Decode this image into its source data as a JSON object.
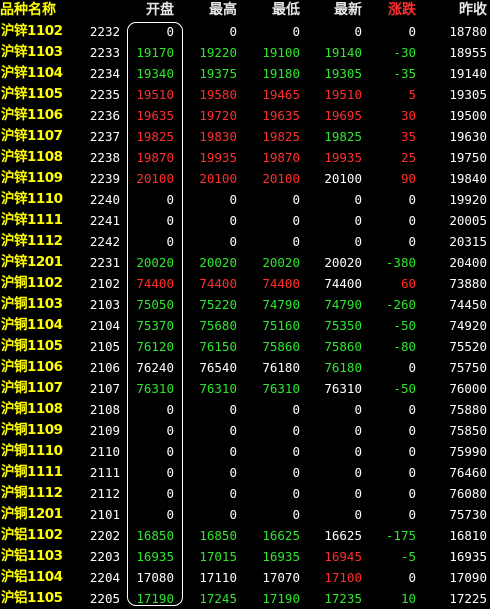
{
  "colors": {
    "up": "#ff2d2d",
    "down": "#2ee62e",
    "flat": "#ffffff",
    "name": "#ffff00",
    "header": "#e6e6e6",
    "code": "#ffffff",
    "prev_close": "#ffffff"
  },
  "header": {
    "name": "品种名称",
    "open": "开盘",
    "high": "最高",
    "low": "最低",
    "last": "最新",
    "change": "涨跌",
    "prev_close": "昨收"
  },
  "rows": [
    {
      "name": "沪锌1102",
      "code": "2232",
      "open": "0",
      "high": "0",
      "low": "0",
      "last": "0",
      "change": "0",
      "prev_close": "18780",
      "open_dir": "flat",
      "high_dir": "flat",
      "low_dir": "flat",
      "last_dir": "flat",
      "change_dir": "flat"
    },
    {
      "name": "沪锌1103",
      "code": "2233",
      "open": "19170",
      "high": "19220",
      "low": "19100",
      "last": "19140",
      "change": "-30",
      "prev_close": "18955",
      "open_dir": "down",
      "high_dir": "down",
      "low_dir": "down",
      "last_dir": "down",
      "change_dir": "down"
    },
    {
      "name": "沪锌1104",
      "code": "2234",
      "open": "19340",
      "high": "19375",
      "low": "19180",
      "last": "19305",
      "change": "-35",
      "prev_close": "19140",
      "open_dir": "down",
      "high_dir": "down",
      "low_dir": "down",
      "last_dir": "down",
      "change_dir": "down"
    },
    {
      "name": "沪锌1105",
      "code": "2235",
      "open": "19510",
      "high": "19580",
      "low": "19465",
      "last": "19510",
      "change": "5",
      "prev_close": "19305",
      "open_dir": "up",
      "high_dir": "up",
      "low_dir": "up",
      "last_dir": "up",
      "change_dir": "up"
    },
    {
      "name": "沪锌1106",
      "code": "2236",
      "open": "19635",
      "high": "19720",
      "low": "19635",
      "last": "19695",
      "change": "30",
      "prev_close": "19500",
      "open_dir": "up",
      "high_dir": "up",
      "low_dir": "up",
      "last_dir": "up",
      "change_dir": "up"
    },
    {
      "name": "沪锌1107",
      "code": "2237",
      "open": "19825",
      "high": "19830",
      "low": "19825",
      "last": "19825",
      "change": "35",
      "prev_close": "19630",
      "open_dir": "up",
      "high_dir": "up",
      "low_dir": "up",
      "last_dir": "down",
      "change_dir": "up"
    },
    {
      "name": "沪锌1108",
      "code": "2238",
      "open": "19870",
      "high": "19935",
      "low": "19870",
      "last": "19935",
      "change": "25",
      "prev_close": "19750",
      "open_dir": "up",
      "high_dir": "up",
      "low_dir": "up",
      "last_dir": "up",
      "change_dir": "up"
    },
    {
      "name": "沪锌1109",
      "code": "2239",
      "open": "20100",
      "high": "20100",
      "low": "20100",
      "last": "20100",
      "change": "90",
      "prev_close": "19840",
      "open_dir": "up",
      "high_dir": "up",
      "low_dir": "up",
      "last_dir": "flat",
      "change_dir": "up"
    },
    {
      "name": "沪锌1110",
      "code": "2240",
      "open": "0",
      "high": "0",
      "low": "0",
      "last": "0",
      "change": "0",
      "prev_close": "19920",
      "open_dir": "flat",
      "high_dir": "flat",
      "low_dir": "flat",
      "last_dir": "flat",
      "change_dir": "flat"
    },
    {
      "name": "沪锌1111",
      "code": "2241",
      "open": "0",
      "high": "0",
      "low": "0",
      "last": "0",
      "change": "0",
      "prev_close": "20005",
      "open_dir": "flat",
      "high_dir": "flat",
      "low_dir": "flat",
      "last_dir": "flat",
      "change_dir": "flat"
    },
    {
      "name": "沪锌1112",
      "code": "2242",
      "open": "0",
      "high": "0",
      "low": "0",
      "last": "0",
      "change": "0",
      "prev_close": "20315",
      "open_dir": "flat",
      "high_dir": "flat",
      "low_dir": "flat",
      "last_dir": "flat",
      "change_dir": "flat"
    },
    {
      "name": "沪锌1201",
      "code": "2231",
      "open": "20020",
      "high": "20020",
      "low": "20020",
      "last": "20020",
      "change": "-380",
      "prev_close": "20400",
      "open_dir": "down",
      "high_dir": "down",
      "low_dir": "down",
      "last_dir": "flat",
      "change_dir": "down"
    },
    {
      "name": "沪铜1102",
      "code": "2102",
      "open": "74400",
      "high": "74400",
      "low": "74400",
      "last": "74400",
      "change": "60",
      "prev_close": "73880",
      "open_dir": "up",
      "high_dir": "up",
      "low_dir": "up",
      "last_dir": "flat",
      "change_dir": "up"
    },
    {
      "name": "沪铜1103",
      "code": "2103",
      "open": "75050",
      "high": "75220",
      "low": "74790",
      "last": "74790",
      "change": "-260",
      "prev_close": "74450",
      "open_dir": "down",
      "high_dir": "down",
      "low_dir": "down",
      "last_dir": "down",
      "change_dir": "down"
    },
    {
      "name": "沪铜1104",
      "code": "2104",
      "open": "75370",
      "high": "75680",
      "low": "75160",
      "last": "75350",
      "change": "-50",
      "prev_close": "74920",
      "open_dir": "down",
      "high_dir": "down",
      "low_dir": "down",
      "last_dir": "down",
      "change_dir": "down"
    },
    {
      "name": "沪铜1105",
      "code": "2105",
      "open": "76120",
      "high": "76150",
      "low": "75860",
      "last": "75860",
      "change": "-80",
      "prev_close": "75520",
      "open_dir": "down",
      "high_dir": "down",
      "low_dir": "down",
      "last_dir": "down",
      "change_dir": "down"
    },
    {
      "name": "沪铜1106",
      "code": "2106",
      "open": "76240",
      "high": "76540",
      "low": "76180",
      "last": "76180",
      "change": "0",
      "prev_close": "75750",
      "open_dir": "flat",
      "high_dir": "flat",
      "low_dir": "flat",
      "last_dir": "down",
      "change_dir": "flat"
    },
    {
      "name": "沪铜1107",
      "code": "2107",
      "open": "76310",
      "high": "76310",
      "low": "76310",
      "last": "76310",
      "change": "-50",
      "prev_close": "76000",
      "open_dir": "down",
      "high_dir": "down",
      "low_dir": "down",
      "last_dir": "flat",
      "change_dir": "down"
    },
    {
      "name": "沪铜1108",
      "code": "2108",
      "open": "0",
      "high": "0",
      "low": "0",
      "last": "0",
      "change": "0",
      "prev_close": "75880",
      "open_dir": "flat",
      "high_dir": "flat",
      "low_dir": "flat",
      "last_dir": "flat",
      "change_dir": "flat"
    },
    {
      "name": "沪铜1109",
      "code": "2109",
      "open": "0",
      "high": "0",
      "low": "0",
      "last": "0",
      "change": "0",
      "prev_close": "75850",
      "open_dir": "flat",
      "high_dir": "flat",
      "low_dir": "flat",
      "last_dir": "flat",
      "change_dir": "flat"
    },
    {
      "name": "沪铜1110",
      "code": "2110",
      "open": "0",
      "high": "0",
      "low": "0",
      "last": "0",
      "change": "0",
      "prev_close": "75990",
      "open_dir": "flat",
      "high_dir": "flat",
      "low_dir": "flat",
      "last_dir": "flat",
      "change_dir": "flat"
    },
    {
      "name": "沪铜1111",
      "code": "2111",
      "open": "0",
      "high": "0",
      "low": "0",
      "last": "0",
      "change": "0",
      "prev_close": "76460",
      "open_dir": "flat",
      "high_dir": "flat",
      "low_dir": "flat",
      "last_dir": "flat",
      "change_dir": "flat"
    },
    {
      "name": "沪铜1112",
      "code": "2112",
      "open": "0",
      "high": "0",
      "low": "0",
      "last": "0",
      "change": "0",
      "prev_close": "76080",
      "open_dir": "flat",
      "high_dir": "flat",
      "low_dir": "flat",
      "last_dir": "flat",
      "change_dir": "flat"
    },
    {
      "name": "沪铜1201",
      "code": "2101",
      "open": "0",
      "high": "0",
      "low": "0",
      "last": "0",
      "change": "0",
      "prev_close": "75730",
      "open_dir": "flat",
      "high_dir": "flat",
      "low_dir": "flat",
      "last_dir": "flat",
      "change_dir": "flat"
    },
    {
      "name": "沪铝1102",
      "code": "2202",
      "open": "16850",
      "high": "16850",
      "low": "16625",
      "last": "16625",
      "change": "-175",
      "prev_close": "16810",
      "open_dir": "down",
      "high_dir": "down",
      "low_dir": "down",
      "last_dir": "flat",
      "change_dir": "down"
    },
    {
      "name": "沪铝1103",
      "code": "2203",
      "open": "16935",
      "high": "17015",
      "low": "16935",
      "last": "16945",
      "change": "-5",
      "prev_close": "16935",
      "open_dir": "down",
      "high_dir": "down",
      "low_dir": "down",
      "last_dir": "up",
      "change_dir": "down"
    },
    {
      "name": "沪铝1104",
      "code": "2204",
      "open": "17080",
      "high": "17110",
      "low": "17070",
      "last": "17100",
      "change": "0",
      "prev_close": "17090",
      "open_dir": "flat",
      "high_dir": "flat",
      "low_dir": "flat",
      "last_dir": "up",
      "change_dir": "flat"
    },
    {
      "name": "沪铝1105",
      "code": "2205",
      "open": "17190",
      "high": "17245",
      "low": "17190",
      "last": "17235",
      "change": "10",
      "prev_close": "17225",
      "open_dir": "down",
      "high_dir": "down",
      "low_dir": "down",
      "last_dir": "down",
      "change_dir": "down"
    }
  ]
}
